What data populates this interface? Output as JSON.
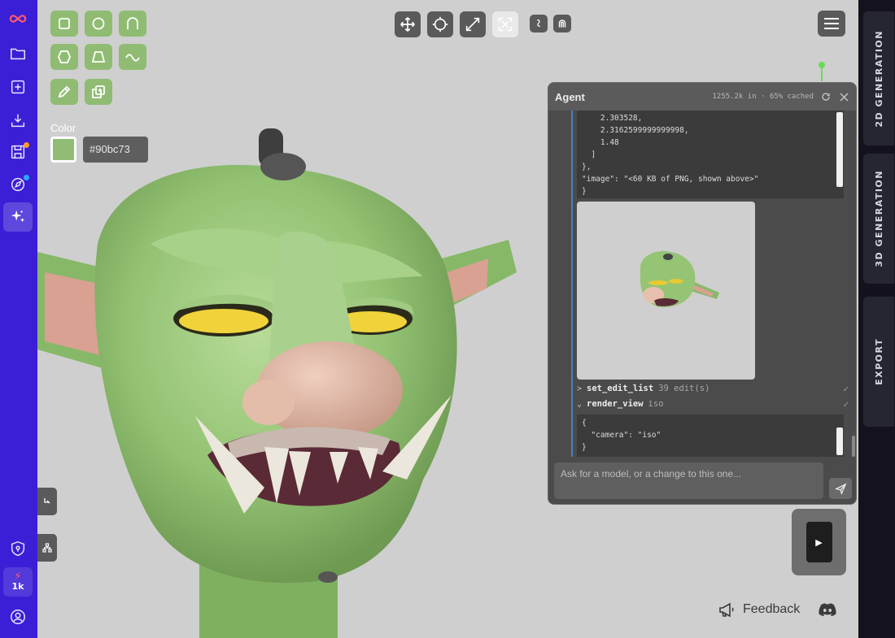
{
  "agent": {
    "title": "Agent",
    "stats": "1255.2k in · 65% cached",
    "code_lines_1": "    2.303528,\n    2.3162599999999998,\n    1.48\n  ]\n},\n\"image\": \"<60 KB of PNG, shown above>\"\n}",
    "tools": [
      {
        "chevron": ">",
        "name": "set_edit_list",
        "meta": "39 edit(s)",
        "status": "✓"
      },
      {
        "chevron": "⌄",
        "name": "render_view",
        "meta": "iso",
        "status": "✓"
      }
    ],
    "code_lines_2": "{\n  \"camera\": \"iso\"\n}",
    "input_placeholder": "Ask for a model, or a change to this one..."
  },
  "color": {
    "label": "Color",
    "hex": "#90bc73",
    "swatch": "#90bc73"
  },
  "credits": {
    "bolt": "⚡",
    "amount": "1k"
  },
  "right_tabs": [
    "2D GENERATION",
    "3D GENERATION",
    "EXPORT"
  ],
  "feedback_label": "Feedback",
  "colors": {
    "sidebar": "#3b1fd6",
    "tool_green": "#8fbc72",
    "right_sidebar": "#14131d",
    "viewport": "#cfcfcf"
  }
}
